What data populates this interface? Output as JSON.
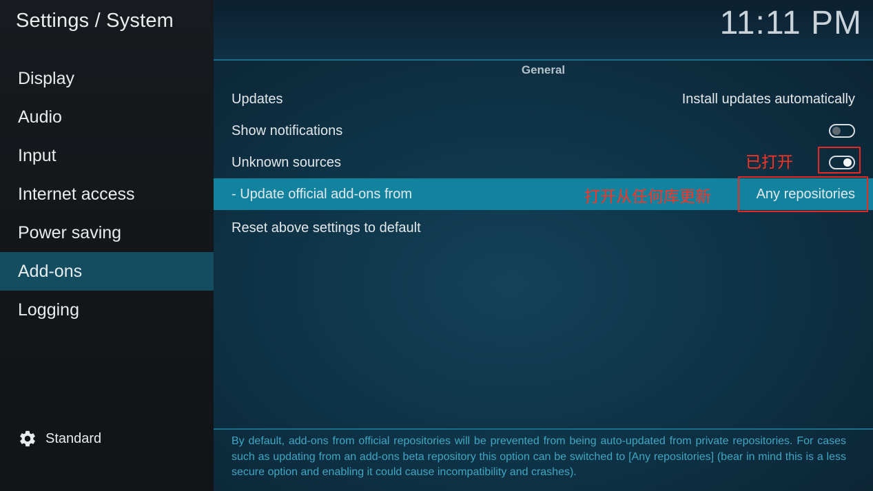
{
  "window": {
    "title": "Settings / System"
  },
  "clock": "11:11 PM",
  "sidebar": {
    "items": [
      {
        "label": "Display"
      },
      {
        "label": "Audio"
      },
      {
        "label": "Input"
      },
      {
        "label": "Internet access"
      },
      {
        "label": "Power saving"
      },
      {
        "label": "Add-ons",
        "selected": true
      },
      {
        "label": "Logging"
      }
    ],
    "footer": {
      "icon": "gear-icon",
      "label": "Standard"
    }
  },
  "main": {
    "section_header": "General",
    "settings": [
      {
        "label": "Updates",
        "value": "Install updates automatically"
      },
      {
        "label": "Show notifications",
        "toggle": "off"
      },
      {
        "label": "Unknown sources",
        "toggle": "on"
      },
      {
        "label": "- Update official add-ons from",
        "value": "Any repositories",
        "focused": true
      },
      {
        "label": "Reset above settings to default"
      }
    ],
    "description": "By default, add-ons from official repositories will be prevented from being auto-updated from private repositories. For cases such as updating from an add-ons beta repository this option can be switched to [Any repositories] (bear in mind this is a less secure option and enabling it could cause incompatibility and crashes)."
  },
  "annotations": {
    "unknown_sources_note": "已打开",
    "update_source_note": "打开从任何库更新",
    "color": "#e42a22"
  },
  "colors": {
    "accent": "#12839f",
    "sidebar_selected": "#144d60",
    "description_text": "#3fa7c3"
  }
}
